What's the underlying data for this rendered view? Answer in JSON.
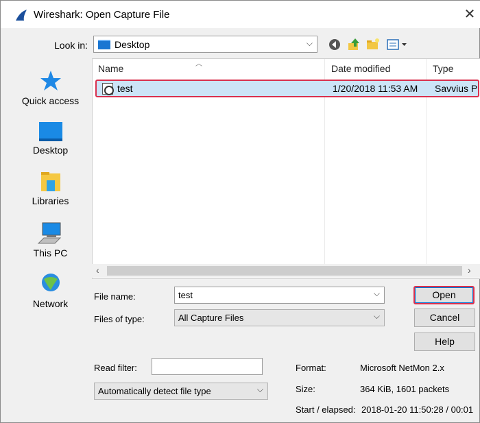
{
  "window": {
    "title": "Wireshark: Open Capture File",
    "close_glyph": "✕"
  },
  "lookin": {
    "label": "Look in:",
    "value": "Desktop"
  },
  "toolbar": {
    "icons": [
      "back-icon",
      "up-folder-icon",
      "new-folder-icon",
      "view-menu-icon"
    ]
  },
  "places": [
    {
      "label": "Quick access",
      "icon": "star-icon"
    },
    {
      "label": "Desktop",
      "icon": "desktop-icon"
    },
    {
      "label": "Libraries",
      "icon": "libraries-icon"
    },
    {
      "label": "This PC",
      "icon": "computer-icon"
    },
    {
      "label": "Network",
      "icon": "network-icon"
    }
  ],
  "filelist": {
    "columns": [
      "Name",
      "Date modified",
      "Type"
    ],
    "rows": [
      {
        "name": "test",
        "date": "1/20/2018 11:53 AM",
        "type": "Savvius Pa"
      }
    ]
  },
  "form": {
    "filename_label": "File name:",
    "filename_value": "test",
    "filetype_label": "Files of type:",
    "filetype_value": "All Capture Files",
    "readfilter_label": "Read filter:",
    "readfilter_value": "",
    "format_mode_value": "Automatically detect file type"
  },
  "buttons": {
    "open": "Open",
    "cancel": "Cancel",
    "help": "Help"
  },
  "details": {
    "format_label": "Format:",
    "format_value": "Microsoft NetMon 2.x",
    "size_label": "Size:",
    "size_value": "364 KiB, 1601 packets",
    "start_label": "Start / elapsed:",
    "start_value": "2018-01-20 11:50:28 / 00:01"
  },
  "colors": {
    "selection": "#cce4f7",
    "highlight_border": "#d9304e",
    "accent": "#0078d7"
  }
}
